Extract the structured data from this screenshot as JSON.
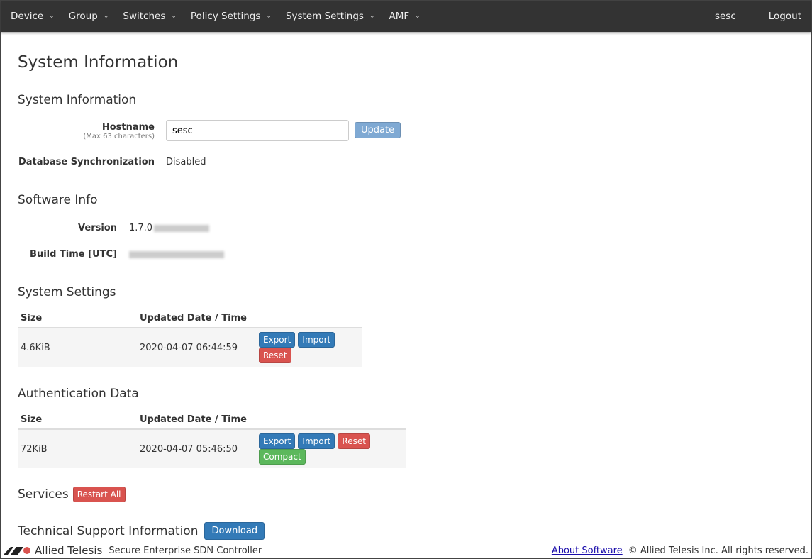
{
  "nav": {
    "items": [
      "Device",
      "Group",
      "Switches",
      "Policy Settings",
      "System Settings",
      "AMF"
    ],
    "user": "sesc",
    "logout": "Logout"
  },
  "page_title": "System Information",
  "sysinfo": {
    "title": "System Information",
    "hostname_label": "Hostname",
    "hostname_hint": "(Max 63 characters)",
    "hostname_value": "sesc",
    "update": "Update",
    "dbsync_label": "Database Synchronization",
    "dbsync_value": "Disabled"
  },
  "software": {
    "title": "Software Info",
    "version_label": "Version",
    "version_value": "1.7.0",
    "build_label": "Build Time [UTC]"
  },
  "settings": {
    "title": "System Settings",
    "headers": [
      "Size",
      "Updated Date / Time"
    ],
    "size": "4.6KiB",
    "date": "2020-04-07 06:44:59",
    "export": "Export",
    "import": "Import",
    "reset": "Reset"
  },
  "auth": {
    "title": "Authentication Data",
    "headers": [
      "Size",
      "Updated Date / Time"
    ],
    "size": "72KiB",
    "date": "2020-04-07 05:46:50",
    "export": "Export",
    "import": "Import",
    "reset": "Reset",
    "compact": "Compact"
  },
  "services": {
    "title": "Services",
    "restart": "Restart All"
  },
  "support": {
    "title": "Technical Support Information",
    "download": "Download"
  },
  "footer": {
    "brand": "Allied Telesis",
    "product": "Secure Enterprise SDN Controller",
    "about": "About Software",
    "copyright": "© Allied Telesis Inc. All rights reserved."
  },
  "colors": {
    "nav": "#333333",
    "primary": "#337ab7",
    "danger": "#d9534f",
    "success": "#5cb85c"
  }
}
